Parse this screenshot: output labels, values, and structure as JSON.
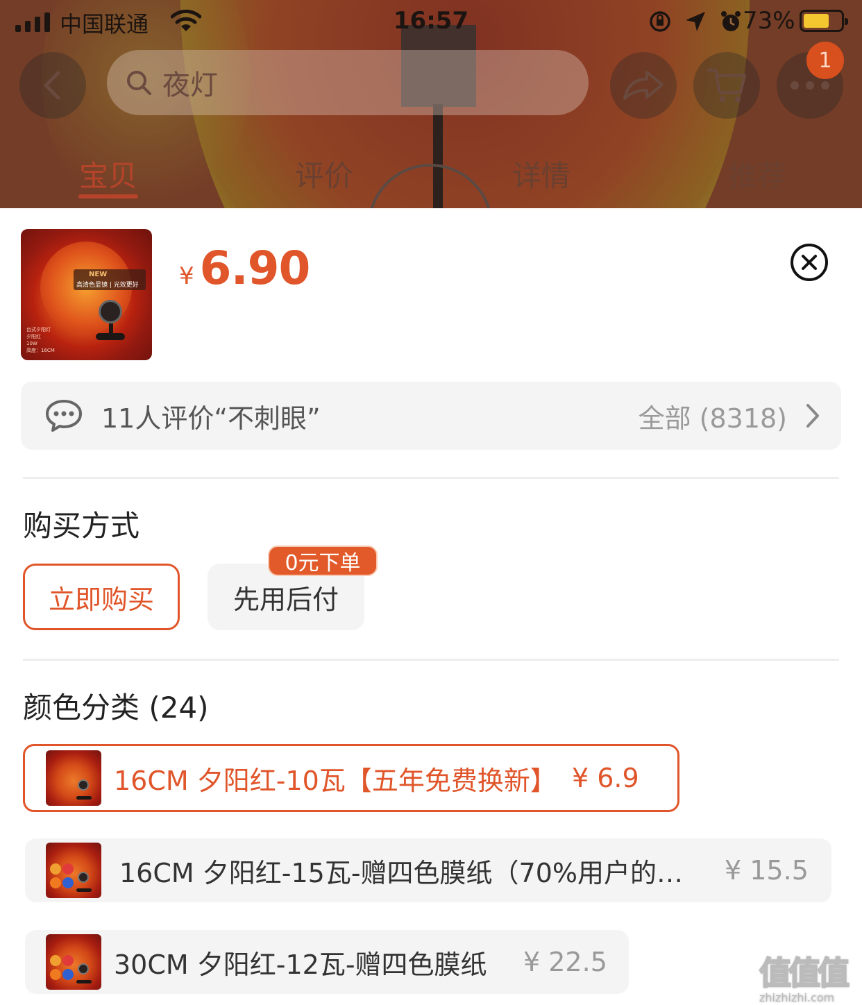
{
  "status_bar": {
    "carrier": "中国联通",
    "time": "16:57",
    "battery": "73%"
  },
  "nav": {
    "search_placeholder": "夜灯",
    "cart_badge": "1"
  },
  "tabs": [
    {
      "label": "宝贝"
    },
    {
      "label": "评价"
    },
    {
      "label": "详情"
    },
    {
      "label": "推荐"
    }
  ],
  "product": {
    "currency": "¥",
    "price": "6.90",
    "thumb": {
      "badge": "NEW",
      "tagline": "高清色显镜 | 光效更好",
      "spec_lines": [
        "台式夕阳灯",
        "夕阳红",
        "10W",
        "高度：16CM"
      ]
    }
  },
  "review_bar": {
    "text": "11人评价“不刺眼”",
    "all": "全部 (8318)"
  },
  "purchase": {
    "title": "购买方式",
    "options": [
      {
        "label": "立即购买"
      },
      {
        "label": "先用后付"
      }
    ],
    "promo": "0元下单"
  },
  "colors": {
    "title": "颜色分类 (24)",
    "items": [
      {
        "label": "16CM 夕阳红-10瓦【五年免费换新】",
        "price": "¥ 6.9"
      },
      {
        "label": "16CM 夕阳红-15瓦-赠四色膜纸（70%用户的…",
        "price": "¥ 15.5"
      },
      {
        "label": "30CM 夕阳红-12瓦-赠四色膜纸",
        "price": "¥ 22.5"
      }
    ]
  },
  "watermark": {
    "big": "值值值",
    "url": "zhizhizhi.com"
  },
  "theme": {
    "accent": "#e0552a",
    "tab_active": "#b5442a"
  }
}
